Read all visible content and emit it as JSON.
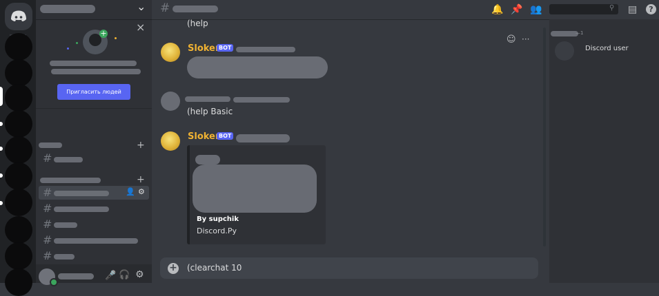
{
  "app": {
    "name": "Discord"
  },
  "invite_panel": {
    "button_label": "Пригласить людей",
    "close_label": "×"
  },
  "sidebar": {
    "add_glyph": "+",
    "hash_glyph": "#",
    "chevron_glyph": "⌄"
  },
  "topbar": {
    "hash_glyph": "#",
    "help_glyph": "?"
  },
  "messages": [
    {
      "text": "(help"
    },
    {
      "author": "Sloker",
      "tag": "BOT"
    },
    {
      "text": "(help Basic"
    },
    {
      "author": "Sloker",
      "tag": "BOT",
      "embed": {
        "footer_title": "By supchik",
        "footer_sub": "Discord.Py"
      }
    }
  ],
  "composer": {
    "value": "(clearchat 10",
    "add_glyph": "+"
  },
  "members": {
    "group_suffix": "—1",
    "member_name": "Discord user"
  },
  "hover_toolbar": {
    "more_glyph": "···"
  },
  "colors": {
    "bot_username": "#f0b232",
    "bot_tag": "#5865f2",
    "invite_button": "#5865f2",
    "online": "#3ba55d"
  }
}
